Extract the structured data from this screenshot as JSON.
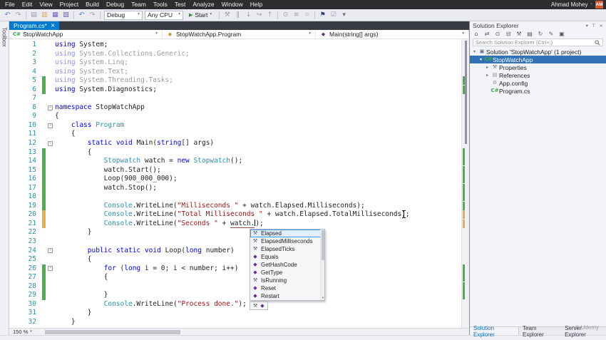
{
  "menubar": {
    "items": [
      "File",
      "Edit",
      "View",
      "Project",
      "Build",
      "Debug",
      "Team",
      "Tools",
      "Test",
      "Analyze",
      "Window",
      "Help"
    ],
    "user_name": "Ahmad Mohey",
    "avatar_initials": "AM"
  },
  "toolbar": {
    "left_icons": [
      "navigate-backward-icon",
      "navigate-forward-icon",
      "sep",
      "new-project-icon",
      "open-file-icon",
      "save-icon",
      "save-all-icon",
      "sep",
      "undo-icon",
      "redo-icon",
      "sep"
    ],
    "debug_config": "Debug",
    "platform": "Any CPU",
    "start_label": "Start",
    "right_icons": [
      "sep",
      "build-icon",
      "break-all-icon",
      "step-into-icon",
      "step-over-icon",
      "step-out-icon",
      "sep",
      "find-icon",
      "comment-icon",
      "uncomment-icon",
      "sep",
      "bookmark-icon",
      "task-list-icon",
      "more-toolbar-options-icon"
    ]
  },
  "doc_tab": {
    "label": "Program.cs*"
  },
  "nav_bar": {
    "project": "StopWatchApp",
    "type": "StopWatchApp.Program",
    "member": "Main(string[] args)"
  },
  "toolbox_label": "Toolbox",
  "editor": {
    "zoom_level": "150 %",
    "lines": [
      {
        "n": 1,
        "segs": [
          [
            "k",
            "using"
          ],
          [
            "d",
            " System;"
          ]
        ]
      },
      {
        "n": 2,
        "dim": true,
        "segs": [
          [
            "k",
            "using"
          ],
          [
            "d",
            " System.Collections.Generic;"
          ]
        ]
      },
      {
        "n": 3,
        "dim": true,
        "segs": [
          [
            "k",
            "using"
          ],
          [
            "d",
            " System.Linq;"
          ]
        ]
      },
      {
        "n": 4,
        "dim": true,
        "segs": [
          [
            "k",
            "using"
          ],
          [
            "d",
            " System.Text;"
          ]
        ]
      },
      {
        "n": 5,
        "dim": true,
        "track": "g",
        "segs": [
          [
            "k",
            "using"
          ],
          [
            "d",
            " System.Threading.Tasks;"
          ]
        ]
      },
      {
        "n": 6,
        "track": "g",
        "segs": [
          [
            "k",
            "using"
          ],
          [
            "d",
            " System.Diagnostics;"
          ]
        ]
      },
      {
        "n": 7,
        "segs": []
      },
      {
        "n": 8,
        "fold": true,
        "segs": [
          [
            "k",
            "namespace"
          ],
          [
            "d",
            " StopWatchApp"
          ]
        ]
      },
      {
        "n": 9,
        "segs": [
          [
            "d",
            "{"
          ]
        ]
      },
      {
        "n": 10,
        "fold": true,
        "segs": [
          [
            "d",
            "    "
          ],
          [
            "k",
            "class"
          ],
          [
            "d",
            " "
          ],
          [
            "t",
            "Program"
          ]
        ]
      },
      {
        "n": 11,
        "segs": [
          [
            "d",
            "    {"
          ]
        ]
      },
      {
        "n": 12,
        "fold": true,
        "segs": [
          [
            "d",
            "        "
          ],
          [
            "k",
            "static"
          ],
          [
            "d",
            " "
          ],
          [
            "k",
            "void"
          ],
          [
            "d",
            " Main("
          ],
          [
            "k",
            "string"
          ],
          [
            "d",
            "[] args)"
          ]
        ]
      },
      {
        "n": 13,
        "track": "g",
        "segs": [
          [
            "d",
            "        {"
          ]
        ]
      },
      {
        "n": 14,
        "track": "g",
        "segs": [
          [
            "d",
            "            "
          ],
          [
            "t",
            "Stopwatch"
          ],
          [
            "d",
            " watch = "
          ],
          [
            "k",
            "new"
          ],
          [
            "d",
            " "
          ],
          [
            "t",
            "Stopwatch"
          ],
          [
            "d",
            "();"
          ]
        ]
      },
      {
        "n": 15,
        "track": "g",
        "segs": [
          [
            "d",
            "            watch.Start();"
          ]
        ]
      },
      {
        "n": 16,
        "track": "g",
        "segs": [
          [
            "d",
            "            Loop(900_000_000);"
          ]
        ]
      },
      {
        "n": 17,
        "track": "g",
        "segs": [
          [
            "d",
            "            watch.Stop();"
          ]
        ]
      },
      {
        "n": 18,
        "track": "g",
        "segs": []
      },
      {
        "n": 19,
        "track": "g",
        "segs": [
          [
            "d",
            "            "
          ],
          [
            "t",
            "Console"
          ],
          [
            "d",
            ".WriteLine("
          ],
          [
            "s",
            "\"Milliseconds \""
          ],
          [
            "d",
            " + watch.Elapsed.Milliseconds);"
          ]
        ]
      },
      {
        "n": 20,
        "track": "y",
        "segs": [
          [
            "d",
            "            "
          ],
          [
            "t",
            "Console"
          ],
          [
            "d",
            ".WriteLine("
          ],
          [
            "s",
            "\"Total Milliseconds \""
          ],
          [
            "d",
            " + watch.Elapsed.TotalMilliseconds);"
          ]
        ]
      },
      {
        "n": 21,
        "track": "y",
        "segs": [
          [
            "d",
            "            "
          ],
          [
            "t",
            "Console"
          ],
          [
            "d",
            ".WriteLine("
          ],
          [
            "s",
            "\"Seconds \""
          ],
          [
            "d",
            " + "
          ],
          [
            "u",
            "watch."
          ],
          [
            "c",
            ""
          ],
          [
            "d",
            ");"
          ]
        ]
      },
      {
        "n": 22,
        "segs": [
          [
            "d",
            "        }"
          ]
        ]
      },
      {
        "n": 23,
        "segs": []
      },
      {
        "n": 24,
        "fold": true,
        "segs": [
          [
            "d",
            "        "
          ],
          [
            "k",
            "public"
          ],
          [
            "d",
            " "
          ],
          [
            "k",
            "static"
          ],
          [
            "d",
            " "
          ],
          [
            "k",
            "void"
          ],
          [
            "d",
            " Loop("
          ],
          [
            "k",
            "long"
          ],
          [
            "d",
            " number)"
          ]
        ]
      },
      {
        "n": 25,
        "segs": [
          [
            "d",
            "        {"
          ]
        ]
      },
      {
        "n": 26,
        "fold": true,
        "track": "g",
        "segs": [
          [
            "d",
            "            "
          ],
          [
            "k",
            "for"
          ],
          [
            "d",
            " ("
          ],
          [
            "k",
            "long"
          ],
          [
            "d",
            " i = 0; i < number; i++)"
          ]
        ]
      },
      {
        "n": 27,
        "track": "g",
        "segs": [
          [
            "d",
            "            {"
          ]
        ]
      },
      {
        "n": 28,
        "track": "g",
        "segs": []
      },
      {
        "n": 29,
        "track": "g",
        "segs": [
          [
            "d",
            "            }"
          ]
        ]
      },
      {
        "n": 30,
        "segs": [
          [
            "d",
            "            "
          ],
          [
            "t",
            "Console"
          ],
          [
            "d",
            ".WriteLine("
          ],
          [
            "s",
            "\"Process done.\""
          ],
          [
            "d",
            ");"
          ]
        ]
      },
      {
        "n": 31,
        "segs": [
          [
            "d",
            "        }"
          ]
        ]
      },
      {
        "n": 32,
        "segs": [
          [
            "d",
            "    }"
          ]
        ]
      }
    ]
  },
  "intellisense": {
    "items": [
      {
        "label": "Elapsed",
        "icon": "property-icon",
        "selected": true
      },
      {
        "label": "ElapsedMilliseconds",
        "icon": "property-icon"
      },
      {
        "label": "ElapsedTicks",
        "icon": "property-icon"
      },
      {
        "label": "Equals",
        "icon": "method-icon"
      },
      {
        "label": "GetHashCode",
        "icon": "method-icon"
      },
      {
        "label": "GetType",
        "icon": "method-icon"
      },
      {
        "label": "IsRunning",
        "icon": "property-icon"
      },
      {
        "label": "Reset",
        "icon": "method-icon"
      },
      {
        "label": "Restart",
        "icon": "method-icon"
      }
    ]
  },
  "solution_explorer": {
    "title": "Solution Explorer",
    "toolbar_icons": [
      "home-icon",
      "switch-views-icon",
      "pending-changes-filter-icon",
      "collapse-all-icon",
      "properties-icon",
      "show-all-files-icon",
      "refresh-icon",
      "view-code-icon",
      "preview-selected-icon"
    ],
    "search_placeholder": "Search Solution Explorer (Ctrl+;)",
    "tree": [
      {
        "label": "Solution 'StopWatchApp' (1 project)",
        "icon": "solution-icon",
        "indent": 0,
        "expander": "expanded"
      },
      {
        "label": "StopWatchApp",
        "icon": "csharp-project-icon",
        "indent": 1,
        "expander": "expanded",
        "selected": true
      },
      {
        "label": "Properties",
        "icon": "properties-folder-icon",
        "indent": 2,
        "expander": "collapsed"
      },
      {
        "label": "References",
        "icon": "references-icon",
        "indent": 2,
        "expander": "collapsed"
      },
      {
        "label": "App.config",
        "icon": "config-file-icon",
        "indent": 2,
        "expander": "none"
      },
      {
        "label": "Program.cs",
        "icon": "csharp-file-icon",
        "indent": 2,
        "expander": "none"
      }
    ],
    "tabs": [
      "Solution Explorer",
      "Team Explorer",
      "Server Explorer"
    ],
    "active_tab": 0
  },
  "watermark": "© Udemy"
}
